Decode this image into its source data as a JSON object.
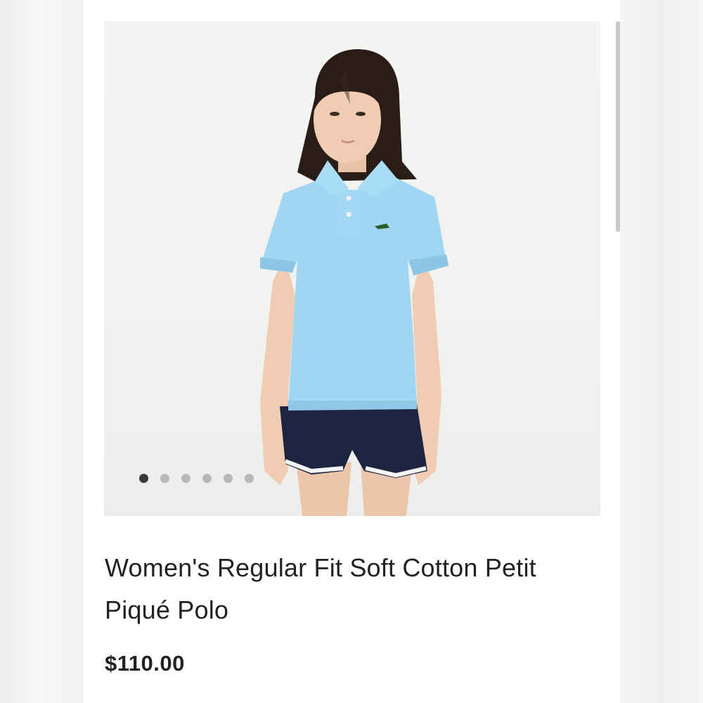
{
  "product": {
    "title": "Women's Regular Fit Soft Cotton Petit Piqué Polo",
    "price": "$110.00",
    "image": {
      "subject": "model-wearing-light-blue-polo-and-navy-shorts",
      "polo_color": "#9fd6f2",
      "shorts_color": "#1c2440"
    },
    "carousel": {
      "total_slides": 6,
      "active_slide": 1
    }
  }
}
